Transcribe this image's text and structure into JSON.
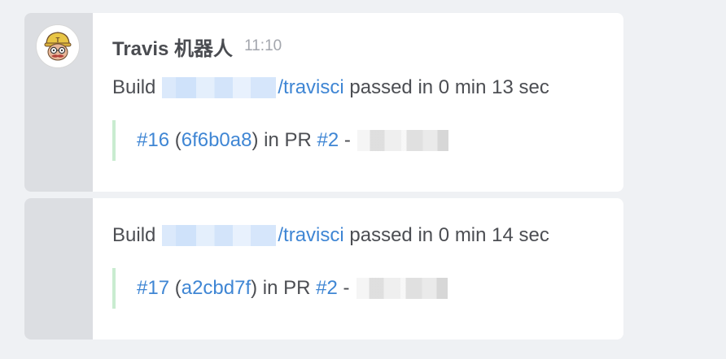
{
  "messages": [
    {
      "sender": "Travis 机器人",
      "time": "11:10",
      "build": {
        "prefix": "Build",
        "repo_suffix": "/travisci",
        "status_text": "passed in 0 min 13 sec"
      },
      "quote": {
        "build_number": "#16",
        "commit": "6f6b0a8",
        "in_pr_text": "in PR",
        "pr_number": "#2",
        "dash": "-"
      }
    },
    {
      "build": {
        "prefix": "Build",
        "repo_suffix": "/travisci",
        "status_text": "passed in 0 min 14 sec"
      },
      "quote": {
        "build_number": "#17",
        "commit": "a2cbd7f",
        "in_pr_text": "in PR",
        "pr_number": "#2",
        "dash": "-"
      }
    }
  ],
  "icons": {
    "avatar": "travis-mascot-icon"
  },
  "colors": {
    "link": "#3f86d4",
    "quote_bar": "#c9ecd0",
    "gutter": "#dcdee2",
    "background": "#eff1f4"
  }
}
